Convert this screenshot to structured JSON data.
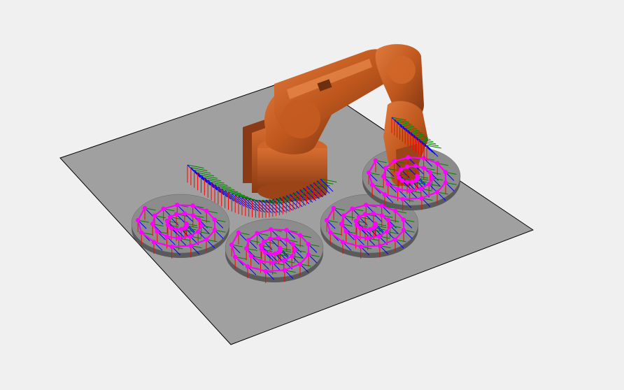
{
  "scene": {
    "background_color": "#f0f0f0",
    "floor_color": "#a0a0a0",
    "floor_edge_color": "#000000",
    "disc_color": "#8c8c8c",
    "robot_color": "#c0581e",
    "robot_shadow_color": "#7e3412",
    "waypoint_color": "#ff00ff",
    "axis_colors": {
      "x": "#ff0000",
      "y": "#008000",
      "z": "#0000ff"
    },
    "disc_count": 4,
    "path": "spiral"
  }
}
